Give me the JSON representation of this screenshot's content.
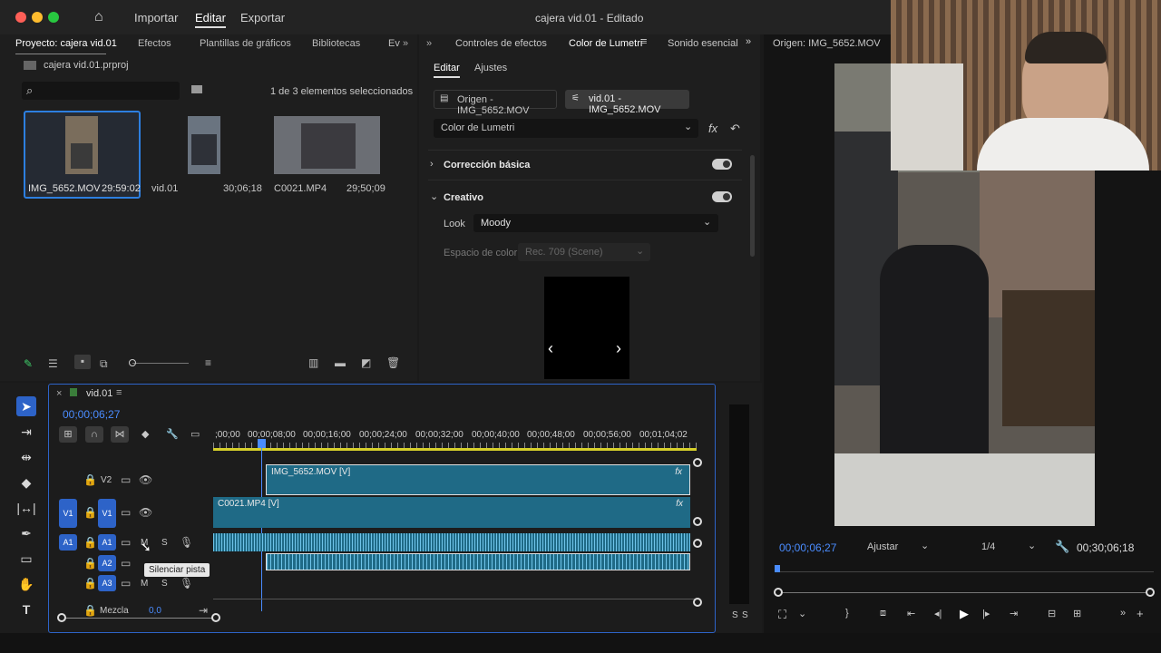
{
  "titlebar": {
    "home": "home-icon",
    "import": "Importar",
    "edit": "Editar",
    "export": "Exportar",
    "title": "cajera vid.01 - Editado"
  },
  "project": {
    "tabs": [
      "Proyecto: cajera vid.01",
      "Efectos",
      "Plantillas de gráficos",
      "Bibliotecas",
      "Ev"
    ],
    "file": "cajera vid.01.prproj",
    "selection": "1 de 3 elementos seleccionados",
    "items": [
      {
        "name": "IMG_5652.MOV",
        "duration": "29:59:02"
      },
      {
        "name": "vid.01",
        "duration": "30;06;18"
      },
      {
        "name": "C0021.MP4",
        "duration": "29;50;09"
      }
    ]
  },
  "lumetri": {
    "tabs": [
      "Controles de efectos",
      "Color de Lumetri",
      "Sonido esencial"
    ],
    "subtabs": [
      "Editar",
      "Ajustes"
    ],
    "source_btn": "Origen - IMG_5652.MOV",
    "seq_btn": "vid.01 - IMG_5652.MOV",
    "effect": "Color de Lumetri",
    "fx": "fx",
    "section1": "Corrección básica",
    "section2": "Creativo",
    "look_label": "Look",
    "look_value": "Moody",
    "colorspace_label": "Espacio de color",
    "colorspace_value": "Rec. 709 (Scene)"
  },
  "source": {
    "title": "Origen: IMG_5652.MOV",
    "timecode": "00;00;06;27",
    "fit": "Ajustar",
    "res": "1/4",
    "duration": "00;30;06;18"
  },
  "timeline": {
    "seq": "vid.01",
    "timecode": "00;00;06;27",
    "ruler": [
      ";00;00",
      "00;00;08;00",
      "00;00;16;00",
      "00;00;24;00",
      "00;00;32;00",
      "00;00;40;00",
      "00;00;48;00",
      "00;00;56;00",
      "00;01;04;02"
    ],
    "tracks": {
      "v2": "V2",
      "v1a": "V1",
      "v1b": "V1",
      "a1a": "A1",
      "a1b": "A1",
      "a2": "A2",
      "a3": "A3",
      "m": "M",
      "s": "S",
      "mix": "Mezcla",
      "mixval": "0,0"
    },
    "clip_v2": "IMG_5652.MOV [V]",
    "clip_v1": "C0021.MP4 [V]",
    "fx": "fx",
    "tooltip": "Silenciar pista"
  },
  "meter": {
    "s1": "S",
    "s2": "S"
  },
  "colors": {
    "accent": "#2d63c8",
    "clip": "#1f6a86",
    "timecode": "#4a8cff"
  }
}
